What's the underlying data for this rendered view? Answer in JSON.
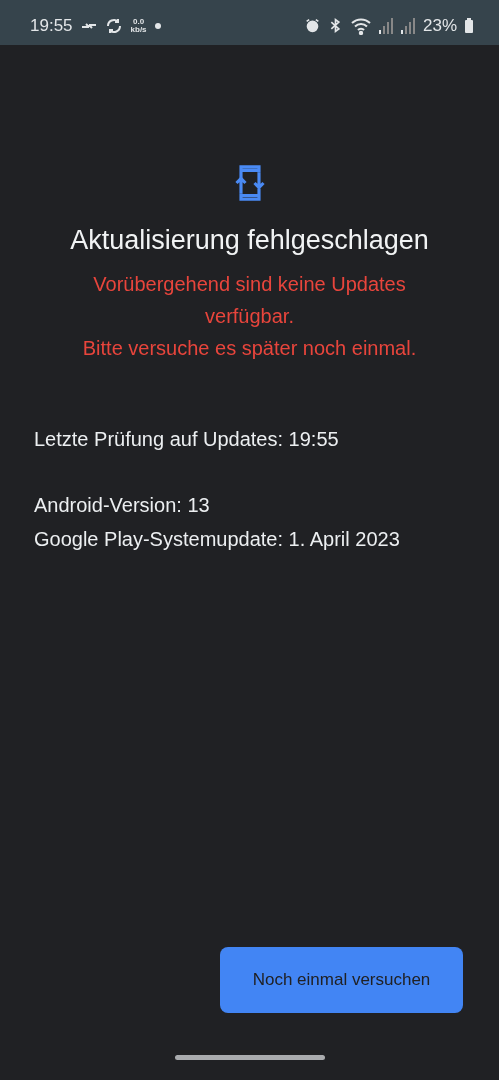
{
  "status_bar": {
    "time": "19:55",
    "net_speed_value": "0.0",
    "net_speed_unit": "kb/s",
    "battery": "23%"
  },
  "title": "Aktualisierung fehlgeschlagen",
  "error_lines": [
    "Vorübergehend sind keine Updates verfügbar.",
    "Bitte versuche es später noch einmal."
  ],
  "last_check": "Letzte Prüfung auf Updates: 19:55",
  "info": [
    "Android-Version: 13",
    "Google Play-Systemupdate: 1. April 2023"
  ],
  "retry_button": "Noch einmal versuchen"
}
